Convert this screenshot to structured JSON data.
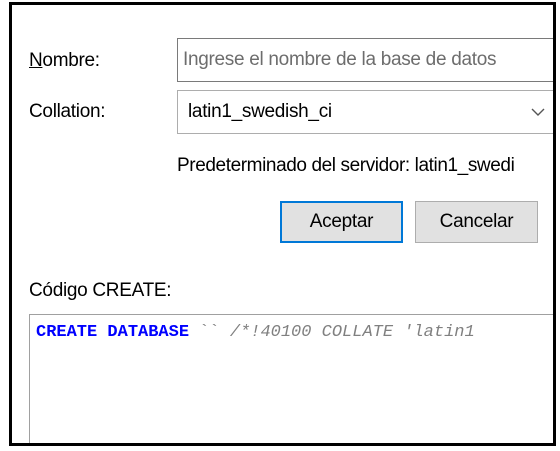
{
  "form": {
    "name_label_first": "N",
    "name_label_rest": "ombre:",
    "name_placeholder": "Ingrese el nombre de la base de datos",
    "name_value": "",
    "collation_label": "Collation:",
    "collation_value": "latin1_swedish_ci",
    "collation_arrow_icon": "chevron-down-icon",
    "default_hint": "Predeterminado del servidor: latin1_swedi"
  },
  "buttons": {
    "accept_label": "Aceptar",
    "cancel_label": "Cancelar"
  },
  "code": {
    "label": "Código CREATE:",
    "keyword": "CREATE DATABASE",
    "identifier": " `` ",
    "comment": "/*!40100 COLLATE 'latin1"
  },
  "colors": {
    "keyword": "#0000ff",
    "comment": "#808080",
    "focus_border": "#0078d7",
    "button_face": "#e1e1e1"
  }
}
